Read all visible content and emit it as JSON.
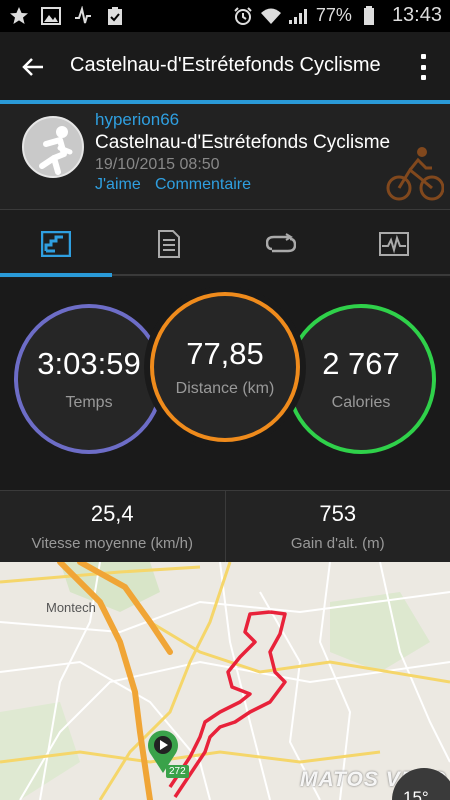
{
  "status_bar": {
    "left_icons": [
      "star-icon",
      "image-icon",
      "activity-icon",
      "clipboard-check-icon"
    ],
    "battery_percent": "77%",
    "time": "13:43"
  },
  "action_bar": {
    "title": "Castelnau-d'Estrétefonds Cyclisme"
  },
  "activity": {
    "username": "hyperion66",
    "name": "Castelnau-d'Estrétefonds Cyclisme",
    "date": "19/10/2015 08:50",
    "like_label": "J'aime",
    "comment_label": "Commentaire",
    "activity_type_icon": "cycling-icon"
  },
  "tabs": [
    {
      "icon": "overview-chart-icon",
      "active": true
    },
    {
      "icon": "details-list-icon",
      "active": false
    },
    {
      "icon": "laps-loop-icon",
      "active": false
    },
    {
      "icon": "graph-pulse-icon",
      "active": false
    }
  ],
  "stats": {
    "time": {
      "value": "3:03:59",
      "label": "Temps",
      "color": "#6d6dc7"
    },
    "distance": {
      "value": "77,85",
      "label": "Distance (km)",
      "color": "#ef8b1c"
    },
    "calories": {
      "value": "2 767",
      "label": "Calories",
      "color": "#2fd14a"
    }
  },
  "sub_stats": [
    {
      "value": "25,4",
      "label": "Vitesse moyenne (km/h)"
    },
    {
      "value": "753",
      "label": "Gain d'alt. (m)"
    }
  ],
  "map": {
    "place_label": "Montech",
    "route_color": "#e8223a",
    "start_badge": "272",
    "watermark": "MATOS VELO",
    "weather_temp": "15°"
  },
  "colors": {
    "accent": "#2a9ad8",
    "link": "#2f9fe0"
  }
}
